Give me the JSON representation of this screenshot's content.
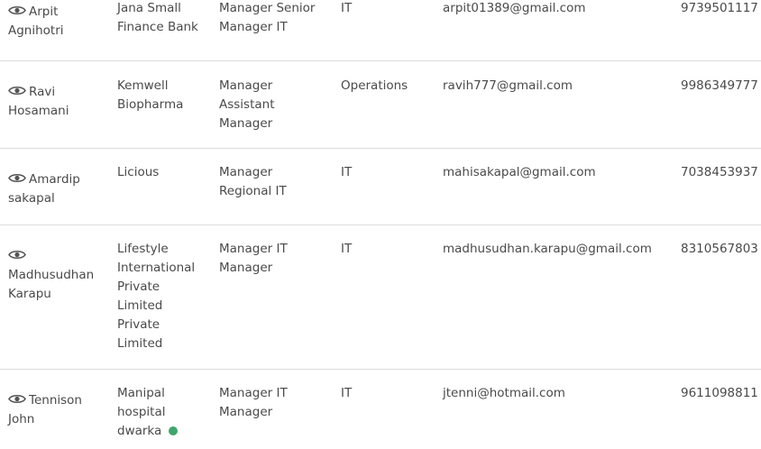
{
  "colors": {
    "text": "#4a4a4a",
    "divider": "#dcdcdc",
    "online_dot": "#3fa66b"
  },
  "icons": {
    "view": "eye-icon"
  },
  "rows": [
    {
      "name_line1": "Arpit",
      "name_line2": "Agnihotri",
      "company_lines": [
        "Jana Small",
        "Finance Bank"
      ],
      "designation_lines": [
        "Manager Senior",
        "Manager IT"
      ],
      "department": "IT",
      "email": "arpit01389@gmail.com",
      "phone": "9739501117"
    },
    {
      "name_line1": "Ravi",
      "name_line2": "Hosamani",
      "company_lines": [
        "Kemwell",
        "Biopharma"
      ],
      "designation_lines": [
        "Manager",
        "Assistant",
        "Manager"
      ],
      "department": "Operations",
      "email": "ravih777@gmail.com",
      "phone": "9986349777"
    },
    {
      "name_line1": "Amardip",
      "name_line2": "sakapal",
      "company_lines": [
        "Licious"
      ],
      "designation_lines": [
        "Manager",
        "Regional IT"
      ],
      "department": "IT",
      "email": "mahisakapal@gmail.com",
      "phone": "7038453937"
    },
    {
      "name_line1": "",
      "name_line2": "Madhusudhan",
      "name_line3": "Karapu",
      "company_lines": [
        "Lifestyle",
        "International",
        "Private",
        "Limited",
        "Private",
        "Limited"
      ],
      "designation_lines": [
        "Manager IT",
        "Manager"
      ],
      "department": "IT",
      "email": "madhusudhan.karapu@gmail.com",
      "phone": "8310567803"
    },
    {
      "name_line1": "Tennison",
      "name_line2": "John",
      "company_lines": [
        "Manipal",
        "hospital",
        "dwarka"
      ],
      "designation_lines": [
        "Manager IT",
        "Manager"
      ],
      "department": "IT",
      "email": "jtenni@hotmail.com",
      "phone": "9611098811",
      "status": "online"
    }
  ]
}
